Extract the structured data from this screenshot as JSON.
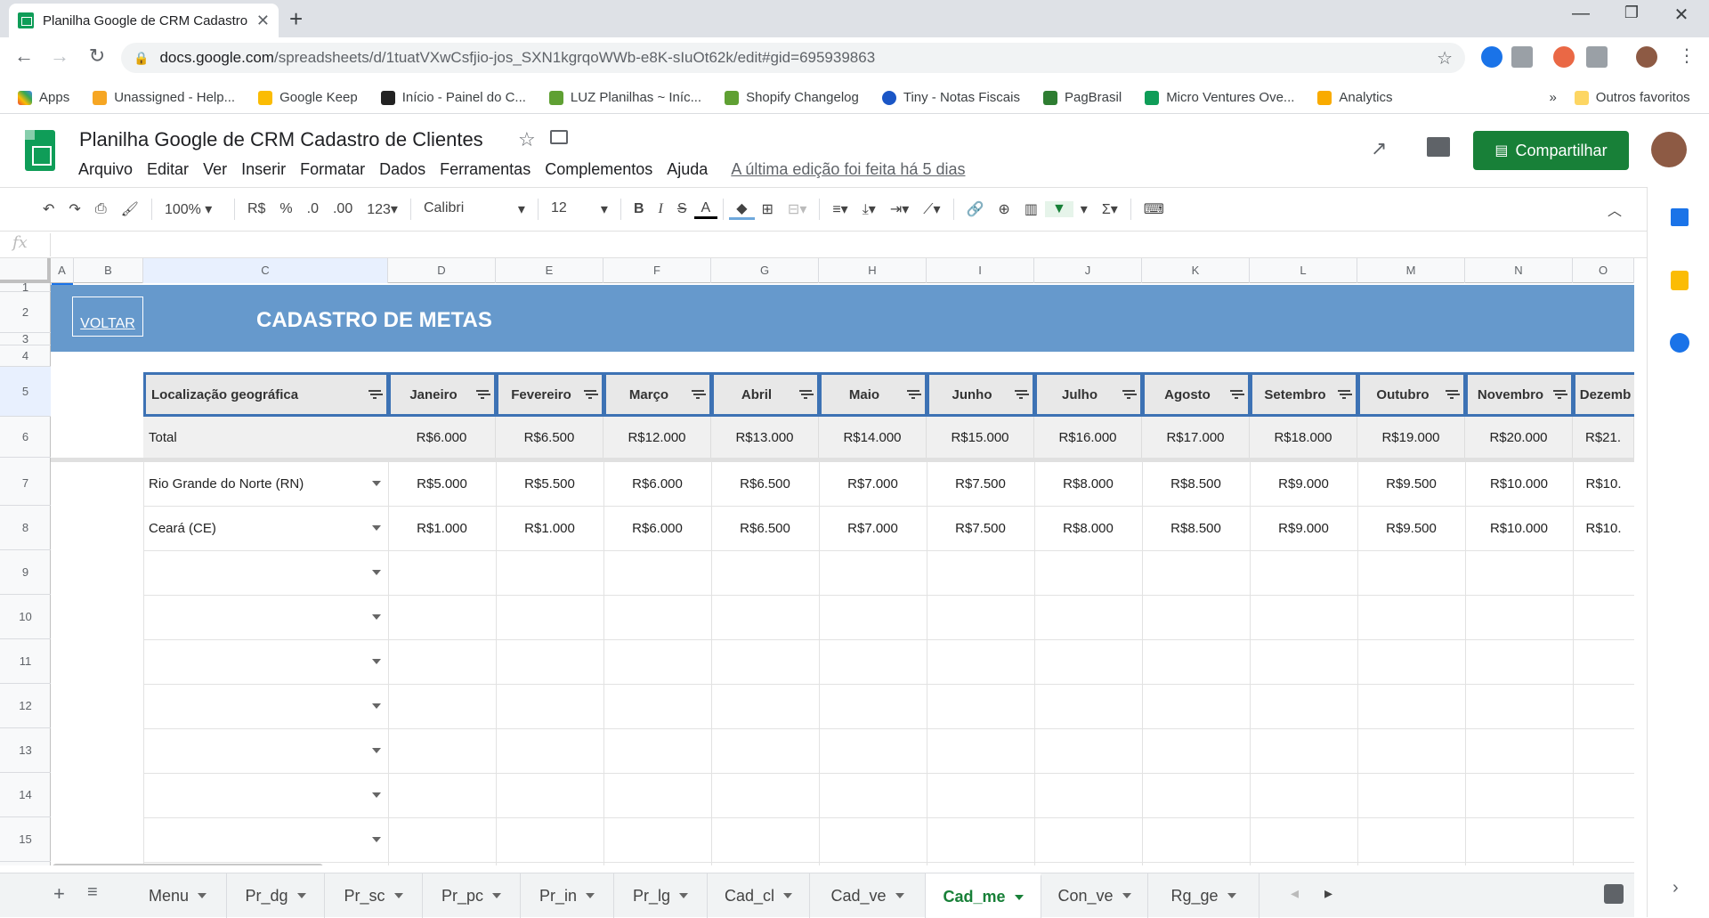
{
  "browser": {
    "tab_title": "Planilha Google de CRM Cadastro de Clientes",
    "url_host": "docs.google.com",
    "url_path": "/spreadsheets/d/1tuatVXwCsfjio-jos_SXN1kgrqoWWb-e8K-sIuOt62k/edit#gid=695939863",
    "bookmarks": [
      "Apps",
      "Unassigned - Help...",
      "Google Keep",
      "Início - Painel do C...",
      "LUZ Planilhas ~ Iníc...",
      "Shopify Changelog",
      "Tiny - Notas Fiscais",
      "PagBrasil",
      "Micro Ventures Ove...",
      "Analytics"
    ],
    "other_bookmarks": "Outros favoritos"
  },
  "sheets": {
    "doc_title": "Planilha  Google de CRM Cadastro de Clientes",
    "menu": [
      "Arquivo",
      "Editar",
      "Ver",
      "Inserir",
      "Formatar",
      "Dados",
      "Ferramentas",
      "Complementos",
      "Ajuda"
    ],
    "last_edit": "A última edição foi feita há 5 dias",
    "share_label": "Compartilhar",
    "toolbar": {
      "zoom": "100%",
      "currency": "R$",
      "percent": "%",
      "dec_less": ".0",
      "dec_more": ".00",
      "format": "123",
      "font": "Calibri",
      "size": "12"
    },
    "fx": "fx"
  },
  "grid": {
    "columns": [
      "A",
      "B",
      "C",
      "D",
      "E",
      "F",
      "G",
      "H",
      "I",
      "J",
      "K",
      "L",
      "M",
      "N",
      "O"
    ],
    "rows": [
      "1",
      "2",
      "3",
      "4",
      "5",
      "6",
      "7",
      "8",
      "9",
      "10",
      "11",
      "12",
      "13",
      "14",
      "15"
    ],
    "voltar": "VOLTAR",
    "banner_title": "CADASTRO DE METAS",
    "header_first": "Localização geográfica",
    "months": [
      "Janeiro",
      "Fevereiro",
      "Março",
      "Abril",
      "Maio",
      "Junho",
      "Julho",
      "Agosto",
      "Setembro",
      "Outubro",
      "Novembro",
      "Dezemb"
    ],
    "total_label": "Total",
    "totals": [
      "R$6.000",
      "R$6.500",
      "R$12.000",
      "R$13.000",
      "R$14.000",
      "R$15.000",
      "R$16.000",
      "R$17.000",
      "R$18.000",
      "R$19.000",
      "R$20.000",
      "R$21."
    ],
    "data_rows": [
      {
        "label": "Rio Grande do Norte (RN)",
        "values": [
          "R$5.000",
          "R$5.500",
          "R$6.000",
          "R$6.500",
          "R$7.000",
          "R$7.500",
          "R$8.000",
          "R$8.500",
          "R$9.000",
          "R$9.500",
          "R$10.000",
          "R$10."
        ]
      },
      {
        "label": "Ceará (CE)",
        "values": [
          "R$1.000",
          "R$1.000",
          "R$6.000",
          "R$6.500",
          "R$7.000",
          "R$7.500",
          "R$8.000",
          "R$8.500",
          "R$9.000",
          "R$9.500",
          "R$10.000",
          "R$10."
        ]
      }
    ]
  },
  "sheet_tabs": [
    "Menu",
    "Pr_dg",
    "Pr_sc",
    "Pr_pc",
    "Pr_in",
    "Pr_lg",
    "Cad_cl",
    "Cad_ve",
    "Cad_me",
    "Con_ve",
    "Rg_ge"
  ],
  "active_tab": "Cad_me"
}
